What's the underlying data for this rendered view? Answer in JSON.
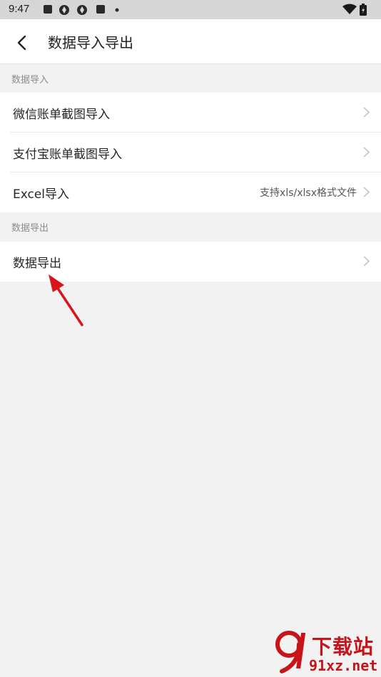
{
  "status_bar": {
    "time": "9:47"
  },
  "header": {
    "title": "数据导入导出"
  },
  "sections": {
    "import": {
      "title": "数据导入",
      "items": [
        {
          "label": "微信账单截图导入",
          "hint": ""
        },
        {
          "label": "支付宝账单截图导入",
          "hint": ""
        },
        {
          "label": "Excel导入",
          "hint": "支持xls/xlsx格式文件"
        }
      ]
    },
    "export": {
      "title": "数据导出",
      "items": [
        {
          "label": "数据导出",
          "hint": ""
        }
      ]
    }
  },
  "watermark": {
    "cn": "下载站",
    "en": "91xz.net"
  },
  "colors": {
    "background": "#f2f2f2",
    "status_bar": "#d6d6d6",
    "annotation_arrow": "#d8141c",
    "watermark": "#c7141a"
  },
  "icons": [
    "back-arrow-icon",
    "chevron-right-icon",
    "wifi-icon",
    "battery-icon",
    "notification-icon"
  ]
}
